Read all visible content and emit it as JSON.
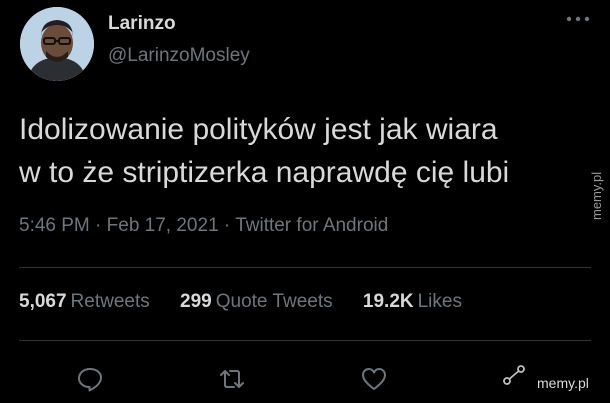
{
  "author": {
    "display_name": "Larinzo",
    "handle": "@LarinzoMosley"
  },
  "tweet": {
    "lines": [
      "Idolizowanie polityków jest jak wiara",
      "w to że striptizerka naprawdę cię lubi"
    ]
  },
  "meta": {
    "time": "5:46 PM",
    "separator": " · ",
    "date": "Feb 17, 2021",
    "source": "Twitter for Android"
  },
  "stats": {
    "retweets_count": "5,067",
    "retweets_label": "Retweets",
    "quote_count": "299",
    "quote_label": "Quote Tweets",
    "likes_count": "19.2K",
    "likes_label": "Likes"
  },
  "actions": {
    "reply_icon": "reply-icon",
    "retweet_icon": "retweet-icon",
    "like_icon": "heart-icon",
    "share_icon": "share-icon",
    "more_icon": "more-horizontal-icon"
  },
  "watermark": {
    "side": "memy.pl",
    "bottom": "memy.pl"
  },
  "colors": {
    "background": "#000000",
    "primary_text": "#d9d9d9",
    "secondary_text": "#6e767d",
    "divider": "#2f3336"
  }
}
